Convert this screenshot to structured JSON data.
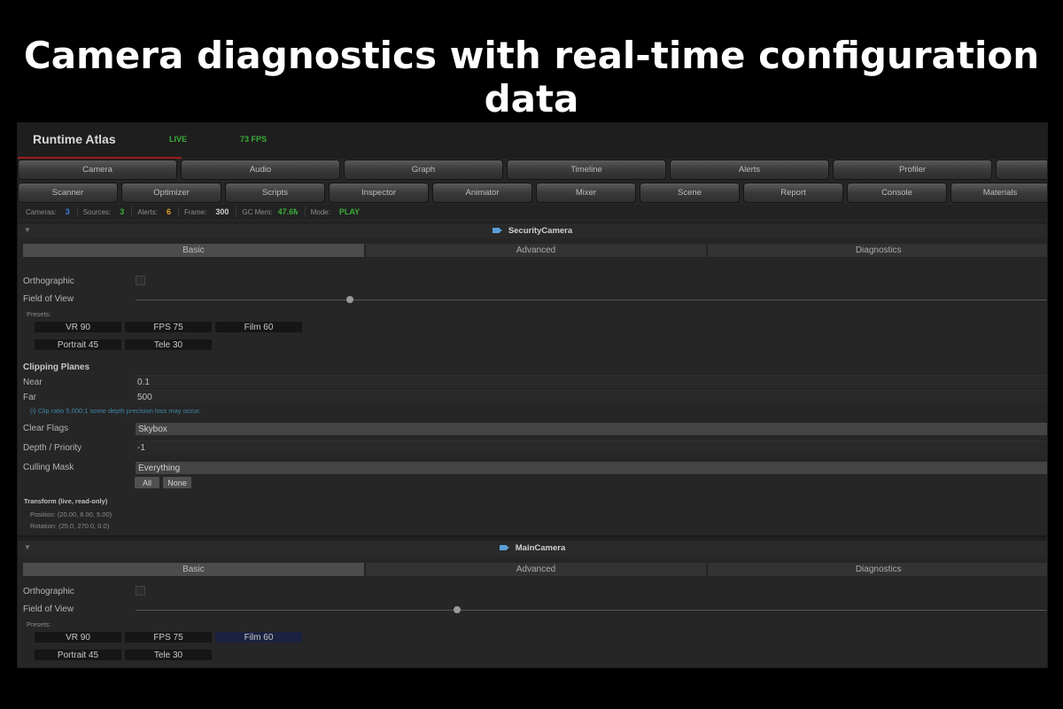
{
  "headline": "Camera diagnostics with real-time configuration data",
  "app": {
    "title": "Runtime Atlas",
    "live": "LIVE",
    "fps": "73 FPS"
  },
  "tabs_row1": [
    "Camera",
    "Audio",
    "Graph",
    "Timeline",
    "Alerts",
    "Profiler",
    ""
  ],
  "tabs_row2": [
    "Scanner",
    "Optimizer",
    "Scripts",
    "Inspector",
    "Animator",
    "Mixer",
    "Scene",
    "Report",
    "Console",
    "Materials"
  ],
  "status": {
    "cameras_label": "Cameras:",
    "cameras": "3",
    "sources_label": "Sources:",
    "sources": "3",
    "alerts_label": "Alerts:",
    "alerts": "6",
    "frame_label": "Frame:",
    "frame": "300",
    "gcmem_label": "GC Mem:",
    "gcmem": "47.6M",
    "mode_label": "Mode:",
    "mode": "PLAY",
    "colors": {
      "cameras": "#3a7be0",
      "sources": "#3aae3a",
      "alerts": "#e0a020",
      "frame": "#d0d0d0",
      "gcmem": "#3aae3a",
      "mode": "#3aae3a"
    }
  },
  "cameras": [
    {
      "name": "SecurityCamera",
      "icon": "video-camera-icon",
      "segments": [
        "Basic",
        "Advanced",
        "Diagnostics"
      ],
      "orthographic_label": "Orthographic",
      "fov_label": "Field of View",
      "fov_slider_fraction": 0.235,
      "presets_label": "Presets:",
      "presets": [
        "VR  90",
        "FPS  75",
        "Film  60",
        "Portrait  45",
        "Tele  30"
      ],
      "selected_preset": -1,
      "clipping_title": "Clipping Planes",
      "near_label": "Near",
      "near": "0.1",
      "far_label": "Far",
      "far": "500",
      "clip_hint": "(i) Clip ratio 5,000:1  some depth precision loss may occur.",
      "clear_flags_label": "Clear Flags",
      "clear_flags": "Skybox",
      "depth_label": "Depth / Priority",
      "depth": "-1",
      "culling_label": "Culling Mask",
      "culling": "Everything",
      "all_label": "All",
      "none_label": "None",
      "transform_title": "Transform  (live, read-only)",
      "position": "Position:  (20.00, 8.00, 5.00)",
      "rotation": "Rotation:  (25.0, 270.0, 0.0)"
    },
    {
      "name": "MainCamera",
      "icon": "video-camera-icon",
      "segments": [
        "Basic",
        "Advanced",
        "Diagnostics"
      ],
      "orthographic_label": "Orthographic",
      "fov_label": "Field of View",
      "fov_slider_fraction": 0.352,
      "presets_label": "Presets:",
      "presets": [
        "VR  90",
        "FPS  75",
        "Film  60",
        "Portrait  45",
        "Tele  30"
      ],
      "selected_preset": 2
    }
  ]
}
